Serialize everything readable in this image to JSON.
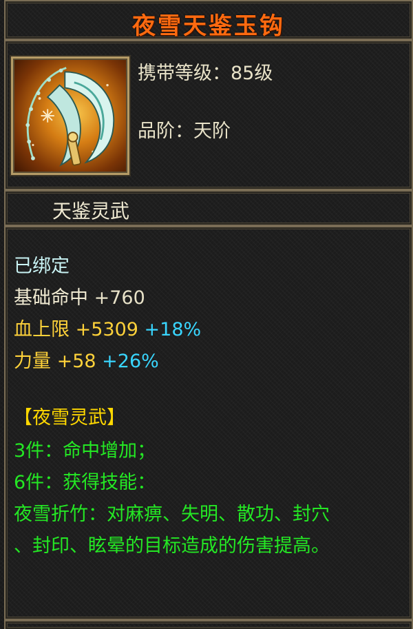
{
  "item": {
    "name": "夜雪天鉴玉钩",
    "carry_level_label": "携带等级：",
    "carry_level_value": "85级",
    "grade_label": "品阶：",
    "grade_value": "天阶",
    "icon": "jade-hook-weapon-icon",
    "sub_name": "天鉴灵武"
  },
  "details": {
    "bound_status": "已绑定",
    "attributes": [
      {
        "name": "基础命中",
        "value": "+760",
        "bonus": ""
      },
      {
        "name": "血上限",
        "value": "+5309",
        "bonus": "+18%"
      },
      {
        "name": "力量",
        "value": "+58",
        "bonus": "+26%"
      }
    ]
  },
  "set": {
    "name": "【夜雪灵武】",
    "bonus_3": "3件：命中增加；",
    "bonus_6": "6件：获得技能：",
    "skill_line1": "夜雪折竹：对麻痹、失明、散功、封穴",
    "skill_line2": "、封印、眩晕的目标造成的伤害提高。"
  },
  "colors": {
    "title": "#ff6a10",
    "label": "#e8e2c8",
    "gold": "#ffd23a",
    "cyan": "#39d6ff",
    "set_green": "#24e824",
    "bound": "#c9f3f4",
    "border": "#7a6d55"
  }
}
